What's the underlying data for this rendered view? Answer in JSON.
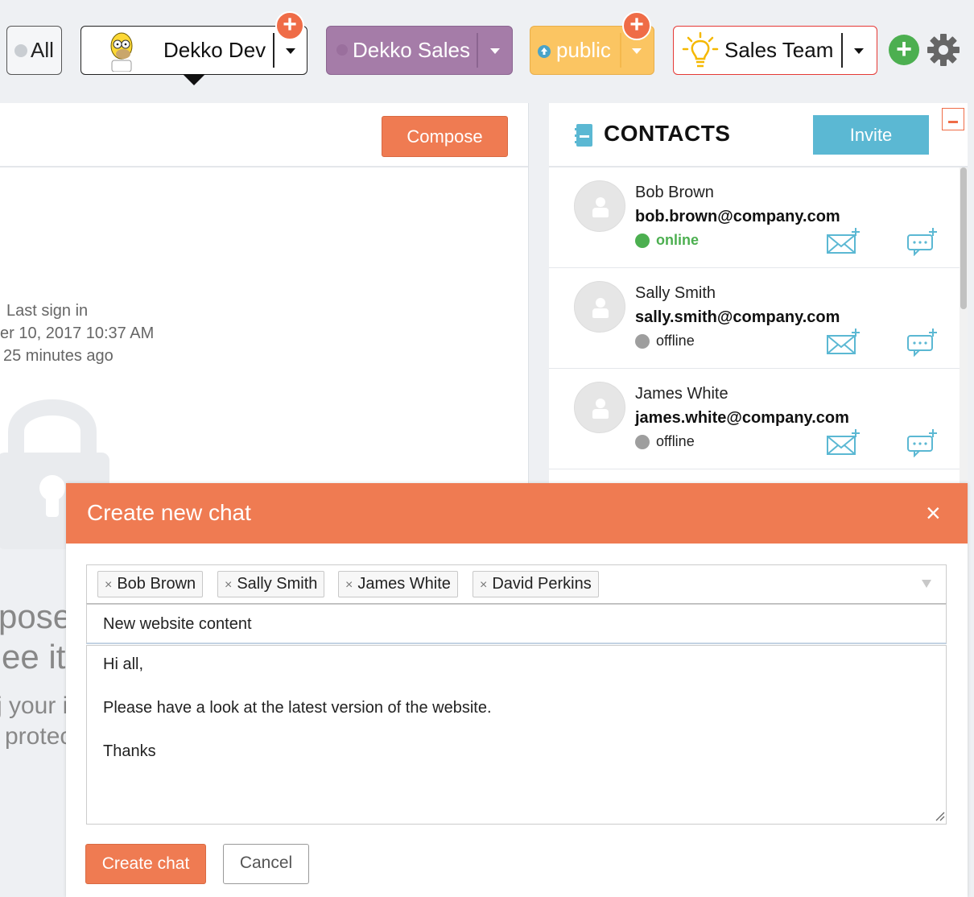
{
  "topbar": {
    "all_label": "All",
    "workspaces": [
      {
        "label": "Dekko Dev",
        "icon": "homer-avatar-icon",
        "selected": true
      },
      {
        "label": "Dekko Sales",
        "color": "#a57ca8"
      },
      {
        "label": "public",
        "color": "#fbc562",
        "icon": "cloud-upload-icon"
      },
      {
        "label": "Sales Team",
        "border_color": "#e53935",
        "icon": "lightbulb-icon"
      }
    ],
    "add_icon": "plus-circle-icon",
    "settings_icon": "gear-icon"
  },
  "left_panel": {
    "compose_label": "Compose",
    "last_sign_in_label": "Last sign in",
    "last_sign_in_date": "er 10, 2017 10:37 AM",
    "last_sign_in_ago": "25 minutes ago",
    "background_fragments": [
      "pose",
      "ee it",
      "j your i",
      "protec"
    ]
  },
  "contacts": {
    "title": "CONTACTS",
    "invite_label": "Invite",
    "items": [
      {
        "name": "Bob Brown",
        "email": "bob.brown@company.com",
        "status": "online",
        "status_color": "#4caf50"
      },
      {
        "name": "Sally Smith",
        "email": "sally.smith@company.com",
        "status": "offline",
        "status_color": "#9e9e9e"
      },
      {
        "name": "James White",
        "email": "james.white@company.com",
        "status": "offline",
        "status_color": "#9e9e9e"
      }
    ]
  },
  "modal": {
    "title": "Create new chat",
    "close_symbol": "×",
    "recipients": [
      "Bob Brown",
      "Sally Smith",
      "James White",
      "David Perkins"
    ],
    "chip_remove_symbol": "×",
    "subject": "New website content",
    "message": "Hi all,\n\nPlease have a look at the latest version of the website.\n\nThanks",
    "create_label": "Create chat",
    "cancel_label": "Cancel"
  },
  "colors": {
    "accent": "#ef7b52",
    "invite": "#5bb8d3",
    "online": "#4caf50",
    "offline": "#9e9e9e"
  }
}
